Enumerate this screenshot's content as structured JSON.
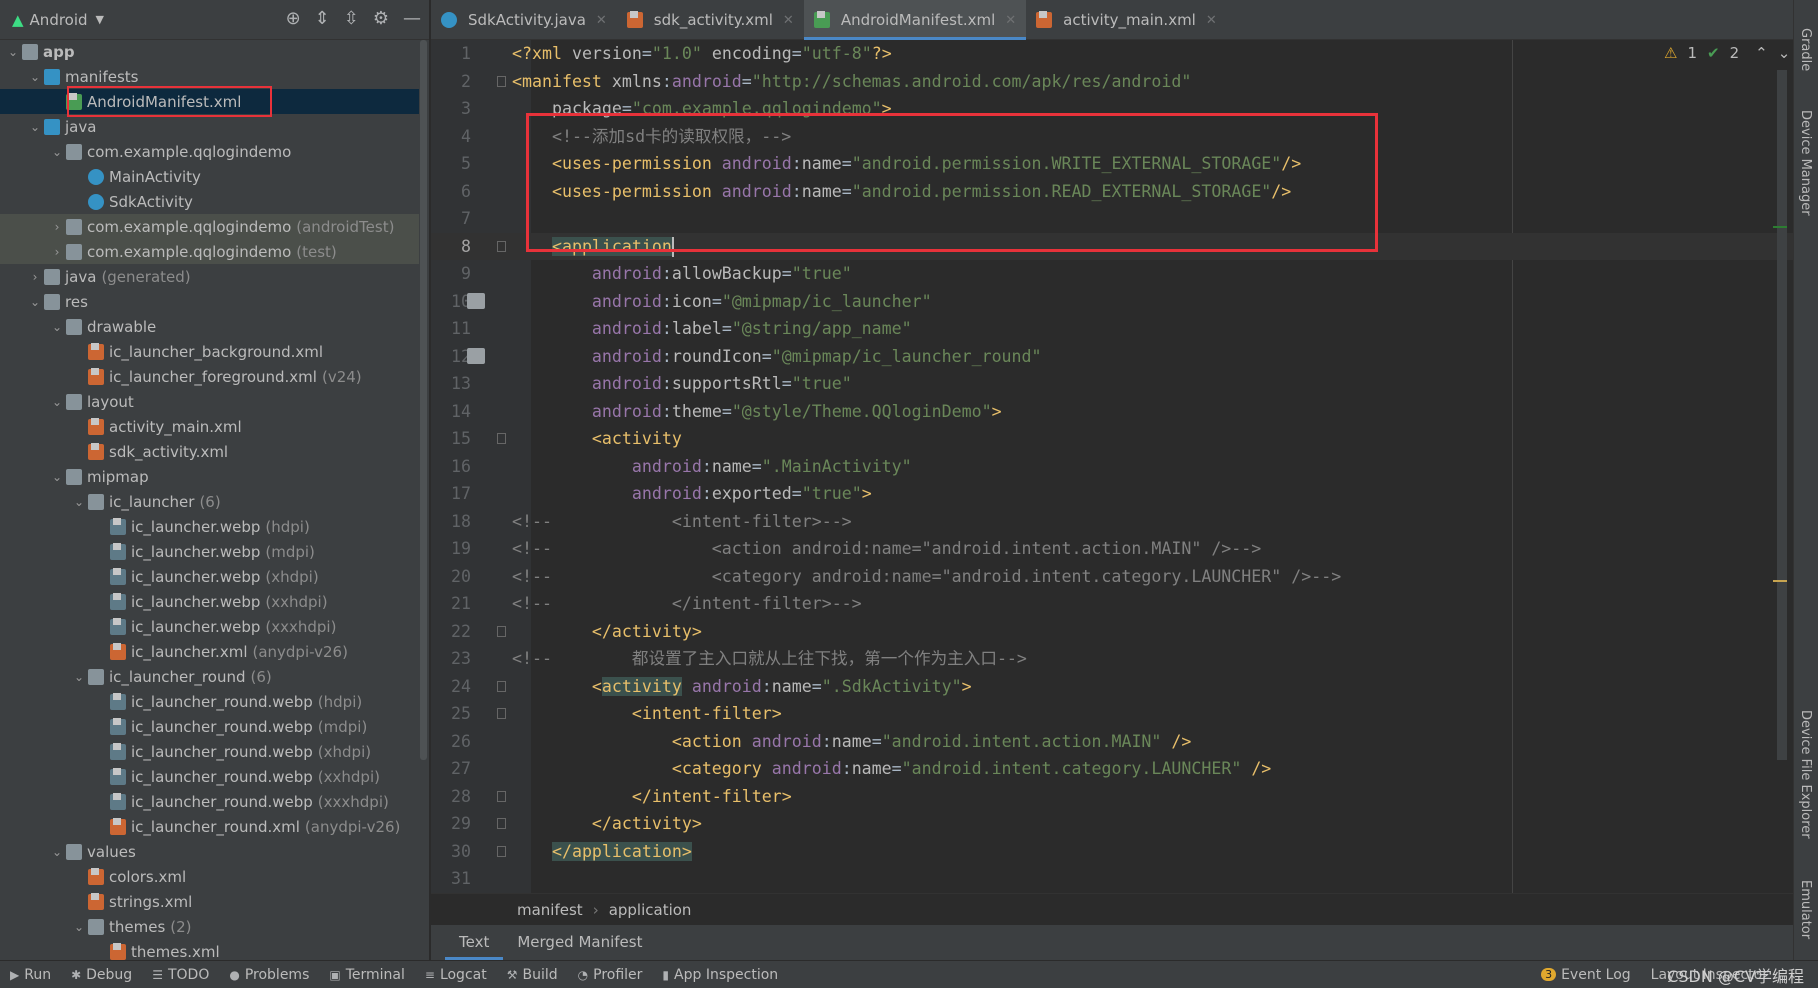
{
  "project_view": {
    "title": "Android",
    "tool_icons": [
      "locate-icon",
      "expand-all-icon",
      "collapse-all-icon",
      "gear-icon",
      "minimize-icon"
    ]
  },
  "tree": [
    {
      "level": 0,
      "arrow": "down",
      "icon": "app",
      "label": "app",
      "bold": true
    },
    {
      "level": 1,
      "arrow": "down",
      "icon": "folder blue",
      "label": "manifests"
    },
    {
      "level": 2,
      "arrow": "",
      "icon": "mf",
      "label": "AndroidManifest.xml",
      "selected": true
    },
    {
      "level": 1,
      "arrow": "down",
      "icon": "folder blue",
      "label": "java"
    },
    {
      "level": 2,
      "arrow": "down",
      "icon": "folder",
      "label": "com.example.qqlogindemo"
    },
    {
      "level": 3,
      "arrow": "",
      "icon": "cls",
      "label": "MainActivity"
    },
    {
      "level": 3,
      "arrow": "",
      "icon": "cls",
      "label": "SdkActivity"
    },
    {
      "level": 2,
      "arrow": "right",
      "icon": "folder",
      "label": "com.example.qqlogindemo",
      "suffix": "(androidTest)",
      "highlight": true
    },
    {
      "level": 2,
      "arrow": "right",
      "icon": "folder",
      "label": "com.example.qqlogindemo",
      "suffix": "(test)",
      "highlight": true
    },
    {
      "level": 1,
      "arrow": "right",
      "icon": "folder",
      "label": "java",
      "suffix": "(generated)"
    },
    {
      "level": 1,
      "arrow": "down",
      "icon": "folder",
      "label": "res"
    },
    {
      "level": 2,
      "arrow": "down",
      "icon": "folder",
      "label": "drawable"
    },
    {
      "level": 3,
      "arrow": "",
      "icon": "xml",
      "label": "ic_launcher_background.xml"
    },
    {
      "level": 3,
      "arrow": "",
      "icon": "xml",
      "label": "ic_launcher_foreground.xml",
      "suffix": "(v24)"
    },
    {
      "level": 2,
      "arrow": "down",
      "icon": "folder",
      "label": "layout"
    },
    {
      "level": 3,
      "arrow": "",
      "icon": "xml",
      "label": "activity_main.xml"
    },
    {
      "level": 3,
      "arrow": "",
      "icon": "xml",
      "label": "sdk_activity.xml"
    },
    {
      "level": 2,
      "arrow": "down",
      "icon": "folder",
      "label": "mipmap"
    },
    {
      "level": 3,
      "arrow": "down",
      "icon": "folder",
      "label": "ic_launcher",
      "suffix": "(6)"
    },
    {
      "level": 4,
      "arrow": "",
      "icon": "img",
      "label": "ic_launcher.webp",
      "suffix": "(hdpi)"
    },
    {
      "level": 4,
      "arrow": "",
      "icon": "img",
      "label": "ic_launcher.webp",
      "suffix": "(mdpi)"
    },
    {
      "level": 4,
      "arrow": "",
      "icon": "img",
      "label": "ic_launcher.webp",
      "suffix": "(xhdpi)"
    },
    {
      "level": 4,
      "arrow": "",
      "icon": "img",
      "label": "ic_launcher.webp",
      "suffix": "(xxhdpi)"
    },
    {
      "level": 4,
      "arrow": "",
      "icon": "img",
      "label": "ic_launcher.webp",
      "suffix": "(xxxhdpi)"
    },
    {
      "level": 4,
      "arrow": "",
      "icon": "xml",
      "label": "ic_launcher.xml",
      "suffix": "(anydpi-v26)"
    },
    {
      "level": 3,
      "arrow": "down",
      "icon": "folder",
      "label": "ic_launcher_round",
      "suffix": "(6)"
    },
    {
      "level": 4,
      "arrow": "",
      "icon": "img",
      "label": "ic_launcher_round.webp",
      "suffix": "(hdpi)"
    },
    {
      "level": 4,
      "arrow": "",
      "icon": "img",
      "label": "ic_launcher_round.webp",
      "suffix": "(mdpi)"
    },
    {
      "level": 4,
      "arrow": "",
      "icon": "img",
      "label": "ic_launcher_round.webp",
      "suffix": "(xhdpi)"
    },
    {
      "level": 4,
      "arrow": "",
      "icon": "img",
      "label": "ic_launcher_round.webp",
      "suffix": "(xxhdpi)"
    },
    {
      "level": 4,
      "arrow": "",
      "icon": "img",
      "label": "ic_launcher_round.webp",
      "suffix": "(xxxhdpi)"
    },
    {
      "level": 4,
      "arrow": "",
      "icon": "xml",
      "label": "ic_launcher_round.xml",
      "suffix": "(anydpi-v26)"
    },
    {
      "level": 2,
      "arrow": "down",
      "icon": "folder",
      "label": "values"
    },
    {
      "level": 3,
      "arrow": "",
      "icon": "xml",
      "label": "colors.xml"
    },
    {
      "level": 3,
      "arrow": "",
      "icon": "xml",
      "label": "strings.xml"
    },
    {
      "level": 3,
      "arrow": "down",
      "icon": "folder",
      "label": "themes",
      "suffix": "(2)"
    },
    {
      "level": 4,
      "arrow": "",
      "icon": "xml",
      "label": "themes.xml"
    }
  ],
  "tabs": [
    {
      "label": "SdkActivity.java",
      "icon": "cls"
    },
    {
      "label": "sdk_activity.xml",
      "icon": "xml"
    },
    {
      "label": "AndroidManifest.xml",
      "icon": "mf",
      "active": true
    },
    {
      "label": "activity_main.xml",
      "icon": "xml"
    }
  ],
  "inspection": {
    "warnings": "1",
    "weak_warnings": "2"
  },
  "current_line": 8,
  "code": [
    [
      [
        "tag",
        "<?xml "
      ],
      [
        "attr",
        "version"
      ],
      [
        "txt",
        "="
      ],
      [
        "val",
        "\"1.0\""
      ],
      [
        "attr",
        " encoding"
      ],
      [
        "txt",
        "="
      ],
      [
        "val",
        "\"utf-8\""
      ],
      [
        "tag",
        "?>"
      ]
    ],
    [
      [
        "tag",
        "<manifest "
      ],
      [
        "attr",
        "xmlns"
      ],
      [
        "txt",
        ":"
      ],
      [
        "ns",
        "android"
      ],
      [
        "txt",
        "="
      ],
      [
        "val",
        "\"http://schemas.android.com/apk/res/android\""
      ]
    ],
    [
      [
        "attr",
        "    package"
      ],
      [
        "txt",
        "="
      ],
      [
        "val",
        "\"com.example.qqlogindemo\""
      ],
      [
        "tag",
        ">"
      ]
    ],
    [
      [
        "com",
        "    <!--添加sd卡的读取权限，-->"
      ]
    ],
    [
      [
        "tag",
        "    <uses-permission "
      ],
      [
        "ns",
        "android"
      ],
      [
        "txt",
        ":"
      ],
      [
        "attr",
        "name"
      ],
      [
        "txt",
        "="
      ],
      [
        "val",
        "\"android.permission.WRITE_EXTERNAL_STORAGE\""
      ],
      [
        "tag",
        "/>"
      ]
    ],
    [
      [
        "tag",
        "    <uses-permission "
      ],
      [
        "ns",
        "android"
      ],
      [
        "txt",
        ":"
      ],
      [
        "attr",
        "name"
      ],
      [
        "txt",
        "="
      ],
      [
        "val",
        "\"android.permission.READ_EXTERNAL_STORAGE\""
      ],
      [
        "tag",
        "/>"
      ]
    ],
    [],
    [
      [
        "txt",
        "    "
      ],
      [
        "tag hl",
        "<application"
      ]
    ],
    [
      [
        "ns",
        "        android"
      ],
      [
        "txt",
        ":"
      ],
      [
        "attr",
        "allowBackup"
      ],
      [
        "txt",
        "="
      ],
      [
        "val",
        "\"true\""
      ]
    ],
    [
      [
        "ns",
        "        android"
      ],
      [
        "txt",
        ":"
      ],
      [
        "attr",
        "icon"
      ],
      [
        "txt",
        "="
      ],
      [
        "val",
        "\"@mipmap/ic_launcher\""
      ]
    ],
    [
      [
        "ns",
        "        android"
      ],
      [
        "txt",
        ":"
      ],
      [
        "attr",
        "label"
      ],
      [
        "txt",
        "="
      ],
      [
        "val",
        "\"@string/app_name\""
      ]
    ],
    [
      [
        "ns",
        "        android"
      ],
      [
        "txt",
        ":"
      ],
      [
        "attr",
        "roundIcon"
      ],
      [
        "txt",
        "="
      ],
      [
        "val",
        "\"@mipmap/ic_launcher_round\""
      ]
    ],
    [
      [
        "ns",
        "        android"
      ],
      [
        "txt",
        ":"
      ],
      [
        "attr",
        "supportsRtl"
      ],
      [
        "txt",
        "="
      ],
      [
        "val",
        "\"true\""
      ]
    ],
    [
      [
        "ns",
        "        android"
      ],
      [
        "txt",
        ":"
      ],
      [
        "attr",
        "theme"
      ],
      [
        "txt",
        "="
      ],
      [
        "val",
        "\"@style/Theme.QQloginDemo\""
      ],
      [
        "tag",
        ">"
      ]
    ],
    [
      [
        "tag",
        "        <activity"
      ]
    ],
    [
      [
        "ns",
        "            android"
      ],
      [
        "txt",
        ":"
      ],
      [
        "attr",
        "name"
      ],
      [
        "txt",
        "="
      ],
      [
        "val",
        "\".MainActivity\""
      ]
    ],
    [
      [
        "ns",
        "            android"
      ],
      [
        "txt",
        ":"
      ],
      [
        "attr",
        "exported"
      ],
      [
        "txt",
        "="
      ],
      [
        "val",
        "\"true\""
      ],
      [
        "tag",
        ">"
      ]
    ],
    [
      [
        "com",
        "<!--            <intent-filter>-->"
      ]
    ],
    [
      [
        "com",
        "<!--                <action android:name=\"android.intent.action.MAIN\" />-->"
      ]
    ],
    [
      [
        "com",
        "<!--                <category android:name=\"android.intent.category.LAUNCHER\" />-->"
      ]
    ],
    [
      [
        "com",
        "<!--            </intent-filter>-->"
      ]
    ],
    [
      [
        "tag",
        "        </activity>"
      ]
    ],
    [
      [
        "com",
        "<!--        都设置了主入口就从上往下找，第一个作为主入口-->"
      ]
    ],
    [
      [
        "tag",
        "        <"
      ],
      [
        "tag hl",
        "activity"
      ],
      [
        "ns",
        " android"
      ],
      [
        "txt",
        ":"
      ],
      [
        "attr",
        "name"
      ],
      [
        "txt",
        "="
      ],
      [
        "val",
        "\".SdkActivity\""
      ],
      [
        "tag",
        ">"
      ]
    ],
    [
      [
        "tag",
        "            <intent-filter>"
      ]
    ],
    [
      [
        "tag",
        "                <action "
      ],
      [
        "ns",
        "android"
      ],
      [
        "txt",
        ":"
      ],
      [
        "attr",
        "name"
      ],
      [
        "txt",
        "="
      ],
      [
        "val",
        "\"android.intent.action.MAIN\""
      ],
      [
        "tag",
        " />"
      ]
    ],
    [
      [
        "tag",
        "                <category "
      ],
      [
        "ns",
        "android"
      ],
      [
        "txt",
        ":"
      ],
      [
        "attr",
        "name"
      ],
      [
        "txt",
        "="
      ],
      [
        "val",
        "\"android.intent.category.LAUNCHER\""
      ],
      [
        "tag",
        " />"
      ]
    ],
    [
      [
        "tag",
        "            </intent-filter>"
      ]
    ],
    [
      [
        "tag",
        "        </activity>"
      ]
    ],
    [
      [
        "txt",
        "    "
      ],
      [
        "tag hl",
        "</application>"
      ]
    ],
    []
  ],
  "breadcrumb": [
    "manifest",
    "application"
  ],
  "bottom_tabs": [
    {
      "label": "Text",
      "active": true
    },
    {
      "label": "Merged Manifest"
    }
  ],
  "right_strip": [
    "Gradle",
    "Device Manager",
    "Device File Explorer",
    "Emulator"
  ],
  "tool_windows": [
    {
      "label": "Run",
      "icon": "▶"
    },
    {
      "label": "Debug",
      "icon": "✱"
    },
    {
      "label": "TODO",
      "icon": "☰"
    },
    {
      "label": "Problems",
      "icon": "●"
    },
    {
      "label": "Terminal",
      "icon": "▣"
    },
    {
      "label": "Logcat",
      "icon": "≡"
    },
    {
      "label": "Build",
      "icon": "⚒"
    },
    {
      "label": "Profiler",
      "icon": "◔"
    },
    {
      "label": "App Inspection",
      "icon": "▮"
    }
  ],
  "status_right": {
    "event_log_count": "3",
    "event_log": "Event Log",
    "layout_inspector": "Layout Inspector"
  },
  "watermark": "CSDN @CV学编程",
  "colors": {
    "tag": "#e8bf6a",
    "attr": "#bababa",
    "namespace": "#9876aa",
    "value": "#6a8759",
    "comment": "#808080",
    "accent": "#4a88c7",
    "annotation_box": "#e8323a"
  }
}
